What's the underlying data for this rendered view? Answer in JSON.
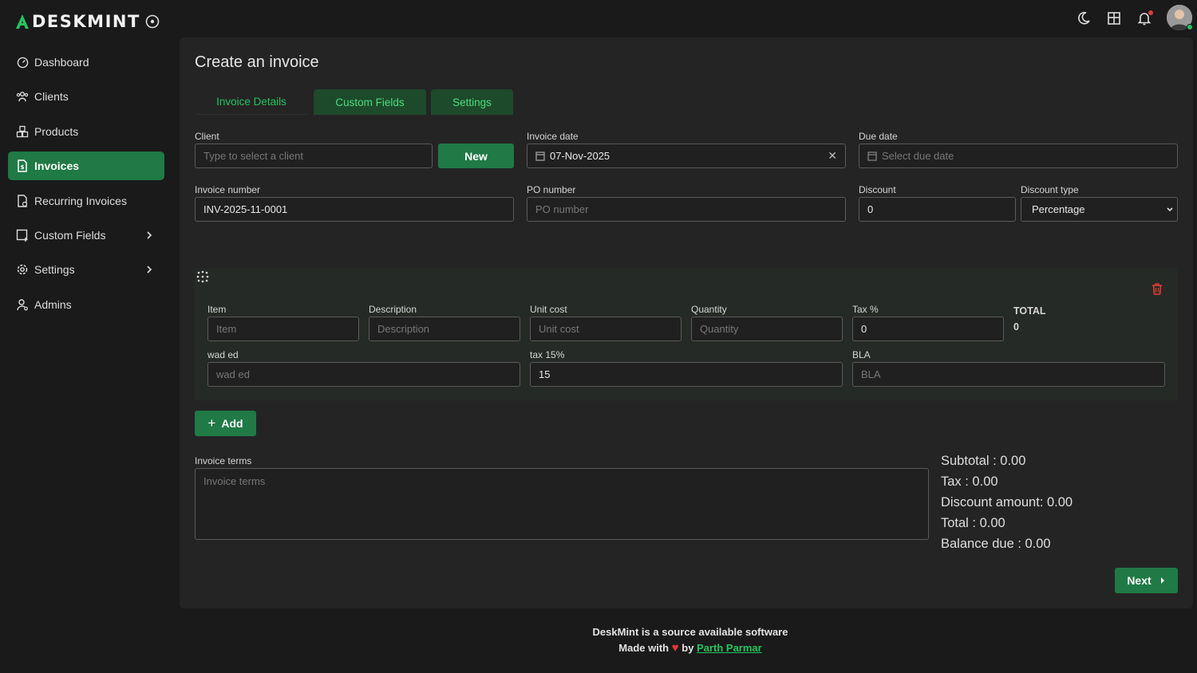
{
  "app": {
    "brand": "DESKMINT"
  },
  "colors": {
    "accent": "#22c55e",
    "button": "#1f7a45",
    "danger": "#e53935"
  },
  "topbar": {
    "icons": [
      "moon-icon",
      "layout-icon",
      "bell-icon"
    ]
  },
  "sidebar": {
    "items": [
      {
        "label": "Dashboard",
        "icon": "dashboard-icon"
      },
      {
        "label": "Clients",
        "icon": "users-icon"
      },
      {
        "label": "Products",
        "icon": "boxes-icon"
      },
      {
        "label": "Invoices",
        "icon": "invoice-icon",
        "active": true
      },
      {
        "label": "Recurring Invoices",
        "icon": "recurring-icon"
      },
      {
        "label": "Custom Fields",
        "icon": "custom-fields-icon",
        "expandable": true
      },
      {
        "label": "Settings",
        "icon": "gear-icon",
        "expandable": true
      },
      {
        "label": "Admins",
        "icon": "admin-icon"
      }
    ]
  },
  "page": {
    "title": "Create an invoice"
  },
  "tabs": [
    "Invoice Details",
    "Custom Fields",
    "Settings"
  ],
  "form": {
    "client": {
      "label": "Client",
      "placeholder": "Type to select a client",
      "new_button": "New"
    },
    "invoice_date": {
      "label": "Invoice date",
      "value": "07-Nov-2025"
    },
    "due_date": {
      "label": "Due date",
      "placeholder": "Select due date"
    },
    "invoice_number": {
      "label": "Invoice number",
      "value": "INV-2025-11-0001"
    },
    "po_number": {
      "label": "PO number",
      "placeholder": "PO number"
    },
    "discount": {
      "label": "Discount",
      "value": "0"
    },
    "discount_type": {
      "label": "Discount type",
      "value": "Percentage"
    }
  },
  "line_item": {
    "item": {
      "label": "Item",
      "placeholder": "Item"
    },
    "description": {
      "label": "Description",
      "placeholder": "Description"
    },
    "unit_cost": {
      "label": "Unit cost",
      "placeholder": "Unit cost"
    },
    "quantity": {
      "label": "Quantity",
      "placeholder": "Quantity"
    },
    "tax": {
      "label": "Tax %",
      "value": "0"
    },
    "total": {
      "label": "TOTAL",
      "value": "0"
    },
    "custom_1": {
      "label": "wad ed",
      "placeholder": "wad ed"
    },
    "custom_2": {
      "label": "tax 15%",
      "value": "15"
    },
    "custom_3": {
      "label": "BLA",
      "placeholder": "BLA"
    }
  },
  "add_button": "Add",
  "terms": {
    "label": "Invoice terms",
    "placeholder": "Invoice terms"
  },
  "summary": {
    "subtotal": "Subtotal : 0.00",
    "tax": "Tax : 0.00",
    "discount": "Discount amount: 0.00",
    "total": "Total : 0.00",
    "balance": "Balance due : 0.00"
  },
  "next_button": "Next",
  "footer": {
    "line1": "DeskMint is a source available software",
    "made_with": "Made with",
    "by": "by",
    "author": "Parth Parmar"
  }
}
